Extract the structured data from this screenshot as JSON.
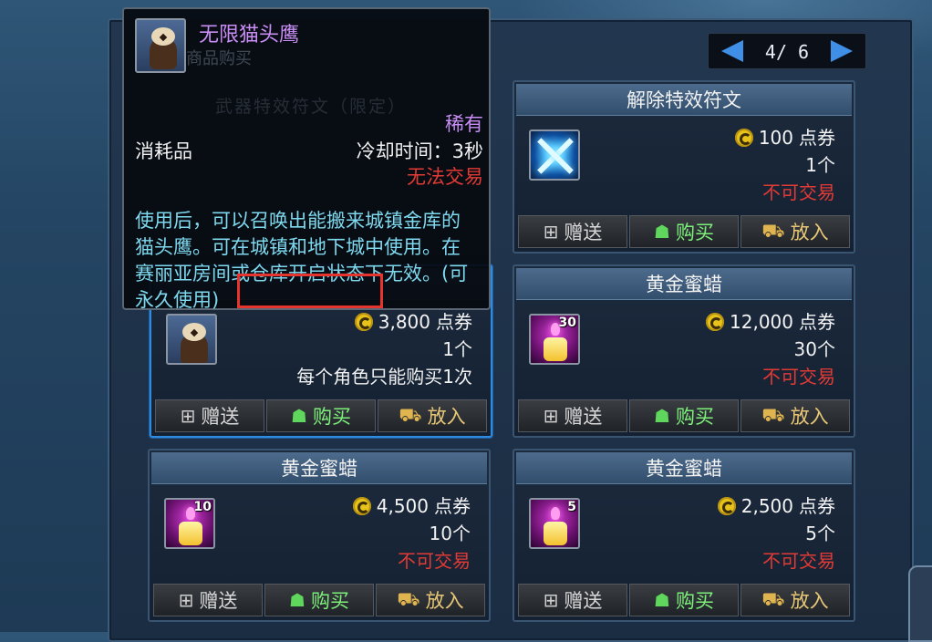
{
  "pager": {
    "page": "4/ 6"
  },
  "cards": [
    {
      "id": "owl",
      "title": "",
      "price": "3,800",
      "price_unit": "点券",
      "quantity": "1个",
      "note": "每个角色只能购买1次",
      "selected": true
    },
    {
      "id": "rune",
      "title": "解除特效符文",
      "price": "100",
      "price_unit": "点券",
      "quantity": "1个",
      "note": "不可交易"
    },
    {
      "id": "candle30",
      "title": "黄金蜜蜡",
      "badge": "30",
      "price": "12,000",
      "price_unit": "点券",
      "quantity": "30个",
      "note": "不可交易"
    },
    {
      "id": "candle10",
      "title": "黄金蜜蜡",
      "badge": "10",
      "price": "4,500",
      "price_unit": "点券",
      "quantity": "10个",
      "note": "不可交易"
    },
    {
      "id": "candle5",
      "title": "黄金蜜蜡",
      "badge": "5",
      "price": "2,500",
      "price_unit": "点券",
      "quantity": "5个",
      "note": "不可交易"
    }
  ],
  "buttons": {
    "gift": "赠送",
    "buy": "购买",
    "cart": "放入"
  },
  "icons": {
    "gift": "gift-icon",
    "buy": "buy-icon",
    "cart": "cart-icon",
    "coin": "coupon-coin-icon"
  },
  "tooltip": {
    "name": "无限猫头鹰",
    "ghost_text": "商品购买",
    "ghost_text2": "武器特效符文（限定）",
    "rarity": "稀有",
    "category": "消耗品",
    "cooldown": "冷却时间：3秒",
    "trade": "无法交易",
    "description": "使用后，可以召唤出能搬来城镇金库的猫头鹰。可在城镇和地下城中使用。在赛丽亚房间或仓库开启状态下无效。(可永久使用)"
  },
  "colors": {
    "price_text": "#f4f4f4",
    "no_trade": "#e23a35",
    "rare": "#c98ef5",
    "desc": "#7ed9ef",
    "highlight_box": "#e5352e"
  }
}
